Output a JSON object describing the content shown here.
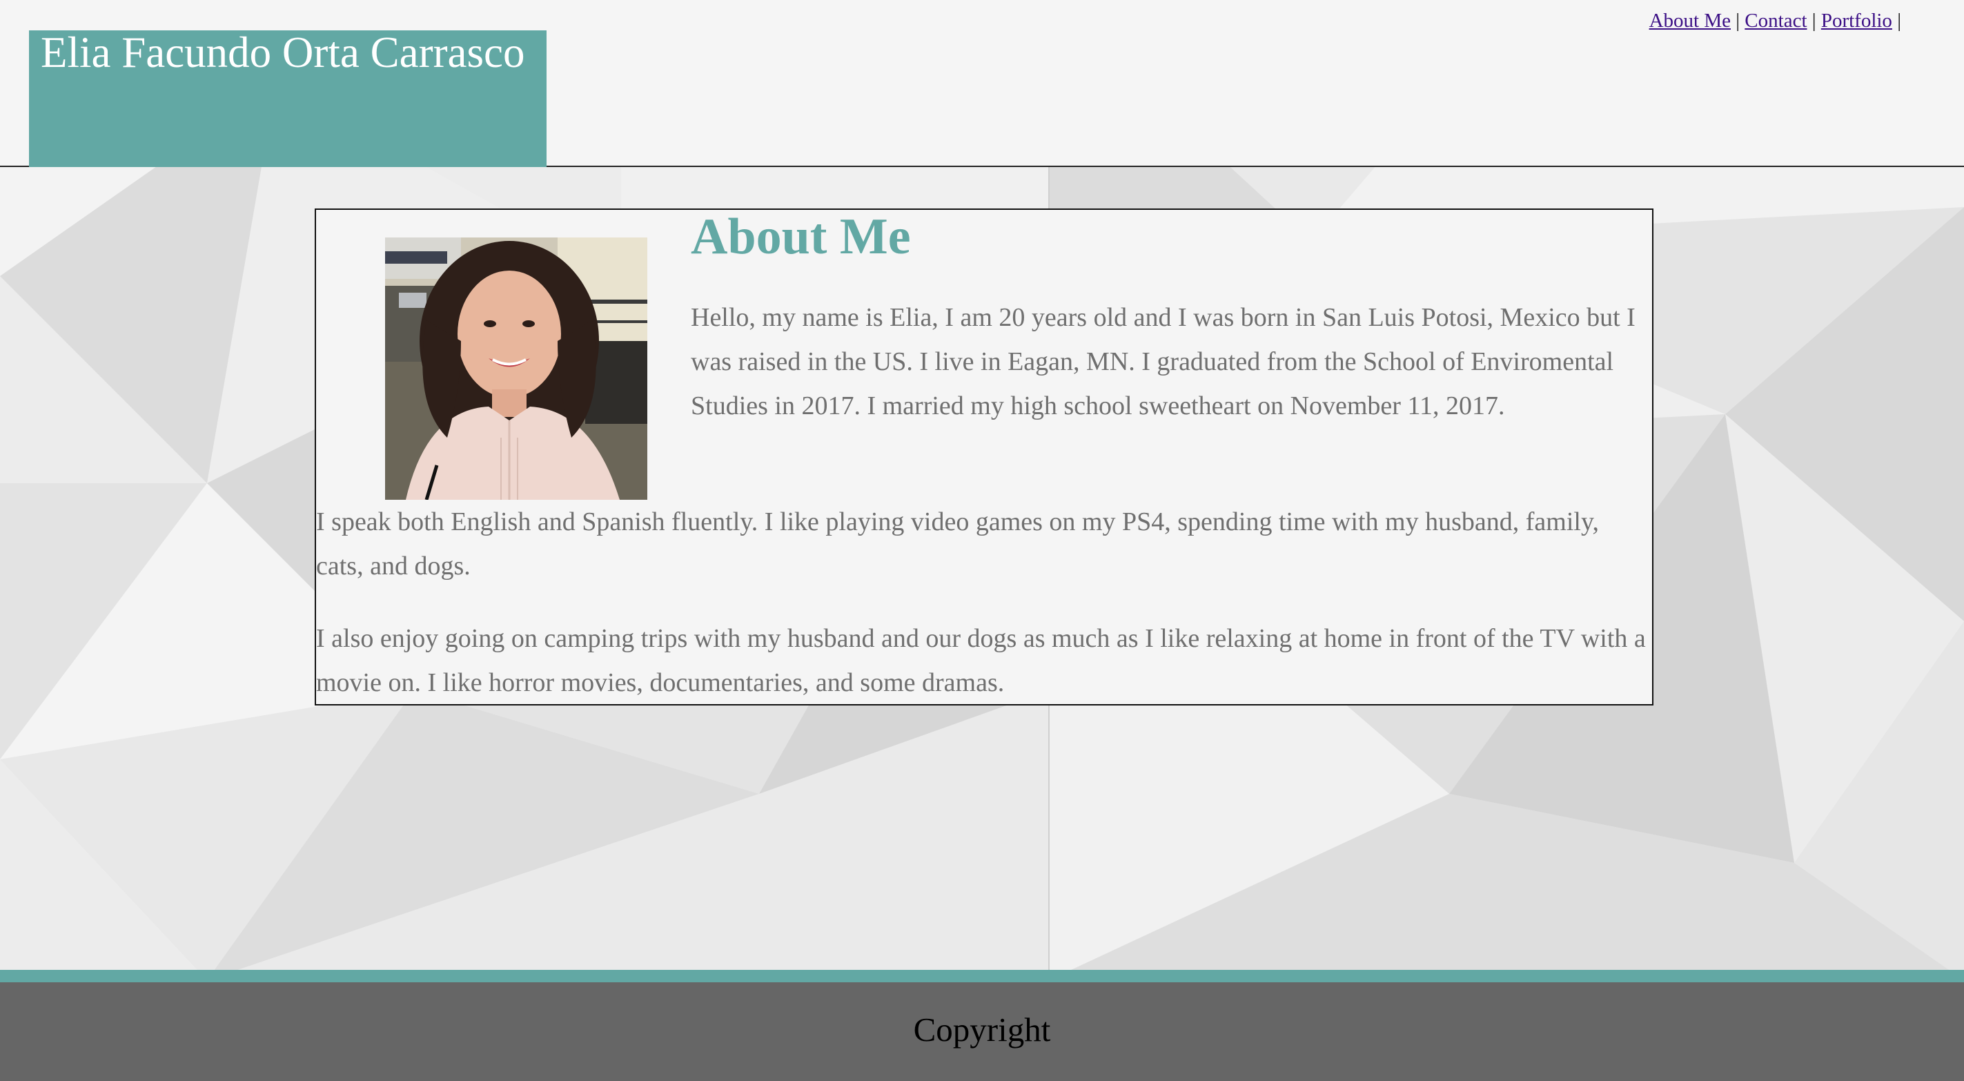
{
  "header": {
    "site_title": "Elia Facundo Orta Carrasco",
    "nav": [
      {
        "label": "About Me"
      },
      {
        "label": "Contact"
      },
      {
        "label": "Portfolio"
      }
    ],
    "separator": "|"
  },
  "main": {
    "heading": "About Me",
    "paragraphs": [
      "Hello, my name is Elia, I am 20 years old and I was born in San Luis Potosi, Mexico but I was raised in the US. I live in Eagan, MN. I graduated from the School of Enviromental Studies in 2017. I married my high school sweetheart on November 11, 2017.",
      "I speak both English and Spanish fluently. I like playing video games on my PS4, spending time with my husband, family, cats, and dogs.",
      "I also enjoy going on camping trips with my husband and our dogs as much as I like relaxing at home in front of the TV with a movie on. I like horror movies, documentaries, and some dramas."
    ]
  },
  "footer": {
    "copyright": "Copyright"
  },
  "colors": {
    "accent": "#62a8a4",
    "header_bg": "#f5f5f5",
    "footer_bg": "#666666",
    "body_text": "#6f6f6f",
    "link": "#3b0f85"
  }
}
